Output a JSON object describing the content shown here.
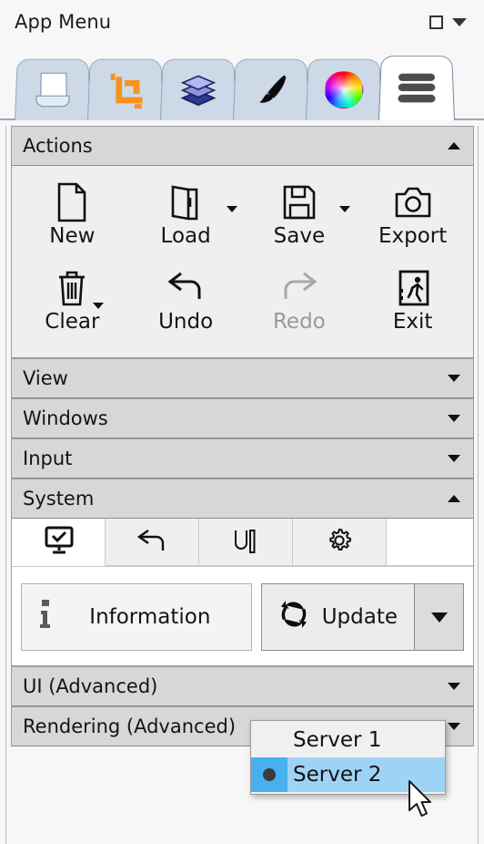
{
  "window": {
    "title": "App Menu",
    "controls": [
      {
        "name": "maximize-button",
        "glyph": "square"
      },
      {
        "name": "menu-dropdown-button",
        "glyph": "triangle-down"
      }
    ]
  },
  "tabs": [
    {
      "id": "document",
      "icon": "page-icon",
      "label": "Document",
      "active": false
    },
    {
      "id": "crop",
      "icon": "crop-icon",
      "label": "Crop",
      "active": false
    },
    {
      "id": "layers",
      "icon": "layers-icon",
      "label": "Layers",
      "active": false
    },
    {
      "id": "brush",
      "icon": "brush-icon",
      "label": "Brush",
      "active": false
    },
    {
      "id": "color",
      "icon": "color-wheel-icon",
      "label": "Color",
      "active": false
    },
    {
      "id": "menu",
      "icon": "hamburger-icon",
      "label": "Menu",
      "active": true
    }
  ],
  "sections": [
    {
      "id": "actions",
      "label": "Actions",
      "expanded": true
    },
    {
      "id": "view",
      "label": "View",
      "expanded": false
    },
    {
      "id": "windows",
      "label": "Windows",
      "expanded": false
    },
    {
      "id": "input",
      "label": "Input",
      "expanded": false
    },
    {
      "id": "system",
      "label": "System",
      "expanded": true
    },
    {
      "id": "ui-advanced",
      "label": "UI (Advanced)",
      "expanded": false
    },
    {
      "id": "rendering-advanced",
      "label": "Rendering (Advanced)",
      "expanded": false
    }
  ],
  "actions": [
    {
      "id": "new",
      "label": "New",
      "icon": "new-file-icon",
      "has_split": false,
      "disabled": false
    },
    {
      "id": "load",
      "label": "Load",
      "icon": "open-folder-icon",
      "has_split": true,
      "disabled": false
    },
    {
      "id": "save",
      "label": "Save",
      "icon": "floppy-disk-icon",
      "has_split": true,
      "disabled": false
    },
    {
      "id": "export",
      "label": "Export",
      "icon": "camera-icon",
      "has_split": false,
      "disabled": false
    },
    {
      "id": "clear",
      "label": "Clear",
      "icon": "trash-icon",
      "has_split": true,
      "disabled": false
    },
    {
      "id": "undo",
      "label": "Undo",
      "icon": "undo-arrow-icon",
      "has_split": false,
      "disabled": false
    },
    {
      "id": "redo",
      "label": "Redo",
      "icon": "redo-arrow-icon",
      "has_split": false,
      "disabled": true
    },
    {
      "id": "exit",
      "label": "Exit",
      "icon": "exit-door-icon",
      "has_split": false,
      "disabled": false
    }
  ],
  "system": {
    "tabs": [
      {
        "id": "status",
        "icon": "monitor-check-icon",
        "active": true
      },
      {
        "id": "restore",
        "icon": "undo-arrow-icon",
        "active": false
      },
      {
        "id": "ui",
        "icon": "ui-text-icon",
        "active": false
      },
      {
        "id": "settings",
        "icon": "gear-icon",
        "active": false
      }
    ],
    "buttons": {
      "information": {
        "label": "Information",
        "icon": "info-icon"
      },
      "update": {
        "label": "Update",
        "icon": "refresh-icon",
        "split": true
      }
    },
    "dropdown": {
      "open": true,
      "selected": "Server 2",
      "options": [
        {
          "label": "Server 1",
          "selected": false
        },
        {
          "label": "Server 2",
          "selected": true
        }
      ]
    }
  },
  "colors": {
    "tab_inactive": "#cdd9e6",
    "tab_active": "#ffffff",
    "section_header": "#d7d7d7",
    "section_body": "#efefef",
    "highlight": "#9fd3f6",
    "highlight_accent": "#48b0ef",
    "crop_orange": "#f7931e",
    "disabled_text": "#9a9a9a"
  }
}
